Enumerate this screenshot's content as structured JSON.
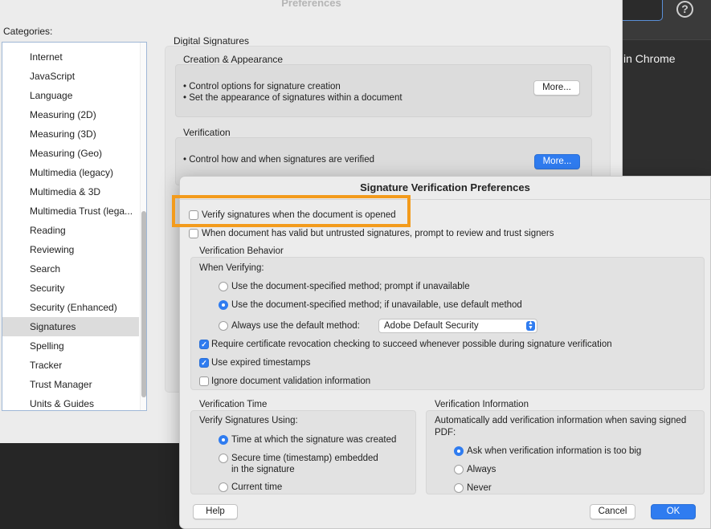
{
  "background_app": {
    "chrome_text": "in Chrome",
    "help_symbol": "?"
  },
  "prefs_window": {
    "title": "Preferences",
    "categories_label": "Categories:",
    "categories": [
      "Internet",
      "JavaScript",
      "Language",
      "Measuring (2D)",
      "Measuring (3D)",
      "Measuring (Geo)",
      "Multimedia (legacy)",
      "Multimedia & 3D",
      "Multimedia Trust (lega...",
      "Reading",
      "Reviewing",
      "Search",
      "Security",
      "Security (Enhanced)",
      "Signatures",
      "Spelling",
      "Tracker",
      "Trust Manager",
      "Units & Guides"
    ],
    "selected_category": "Signatures",
    "section_title": "Digital Signatures",
    "creation": {
      "label": "Creation & Appearance",
      "line1": "• Control options for signature creation",
      "line2": "• Set the appearance of signatures within a document",
      "button": "More..."
    },
    "verification": {
      "label": "Verification",
      "line1": "• Control how and when signatures are verified",
      "button": "More..."
    }
  },
  "dialog": {
    "title": "Signature Verification Preferences",
    "verify_when_opened": {
      "label": "Verify signatures when the document is opened",
      "checked": false
    },
    "prompt_untrusted": {
      "label": "When document has valid but untrusted signatures, prompt to review and trust signers",
      "checked": false
    },
    "behavior": {
      "section_label": "Verification Behavior",
      "when_verifying_label": "When Verifying:",
      "options": [
        {
          "label": "Use the document-specified method; prompt if unavailable",
          "selected": false
        },
        {
          "label": "Use the document-specified method; if unavailable, use default method",
          "selected": true
        },
        {
          "label": "Always use the default method:",
          "selected": false
        }
      ],
      "default_method_value": "Adobe Default Security",
      "require_revocation": {
        "label": "Require certificate revocation checking to succeed whenever possible during signature verification",
        "checked": true
      },
      "use_expired_timestamps": {
        "label": "Use expired timestamps",
        "checked": true
      },
      "ignore_validation_info": {
        "label": "Ignore document validation information",
        "checked": false
      }
    },
    "time": {
      "section_label": "Verification Time",
      "using_label": "Verify Signatures Using:",
      "options": [
        {
          "label": "Time at which the signature was created",
          "selected": true
        },
        {
          "label_line1": "Secure time (timestamp) embedded",
          "label_line2": "in the signature",
          "selected": false
        },
        {
          "label": "Current time",
          "selected": false
        }
      ]
    },
    "info": {
      "section_label": "Verification Information",
      "description_line1": "Automatically add verification information when saving signed",
      "description_line2": "PDF:",
      "options": [
        {
          "label": "Ask when verification information is too big",
          "selected": true
        },
        {
          "label": "Always",
          "selected": false
        },
        {
          "label": "Never",
          "selected": false
        }
      ]
    },
    "buttons": {
      "help": "Help",
      "cancel": "Cancel",
      "ok": "OK"
    }
  },
  "colors": {
    "accent": "#2f7cf0",
    "highlight": "#f39b1c"
  }
}
